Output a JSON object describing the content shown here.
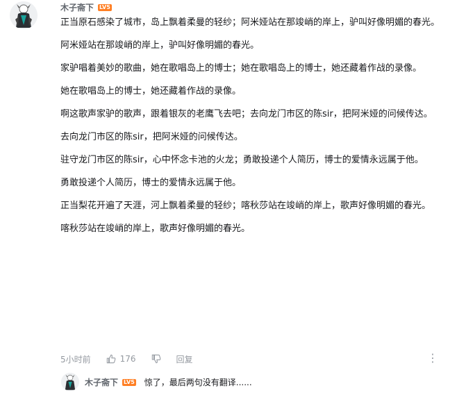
{
  "comment": {
    "username": "木子斋下",
    "level_badge": "LV5",
    "paragraphs": [
      "正当原石感染了城市，岛上飘着柔曼的轻纱；阿米娅站在那竣峭的岸上，驴叫好像明媚的春光。",
      "阿米娅站在那竣峭的岸上，驴叫好像明媚的春光。",
      "家驴唱着美妙的歌曲，她在歌唱岛上的博士；她在歌唱岛上的博士，她还藏着作战的录像。",
      "她在歌唱岛上的博士，她还藏着作战的录像。",
      "啊这歌声家驴的歌声，跟着银灰的老鹰飞去吧；去向龙门市区的陈sir，把阿米娅的问候传达。",
      "去向龙门市区的陈sir，把阿米娅的问候传达。",
      "驻守龙门市区的陈sir，心中怀念卡池的火龙；勇敢投递个人简历，博士的爱情永远属于他。",
      "勇敢投递个人简历，博士的爱情永远属于他。",
      "正当梨花开遍了天涯，河上飘着柔曼的轻纱；喀秋莎站在竣峭的岸上，歌声好像明媚的春光。",
      "喀秋莎站在竣峭的岸上，歌声好像明媚的春光。"
    ],
    "time": "5小时前",
    "likes": "176",
    "reply_label": "回复",
    "more_icon": "⋮"
  },
  "sub_reply": {
    "username": "木子斋下",
    "level_badge": "LV5",
    "text": "惊了，最后两句没有翻译......"
  },
  "colors": {
    "level_badge": "#ff7f24",
    "meta_text": "#9499a0"
  }
}
